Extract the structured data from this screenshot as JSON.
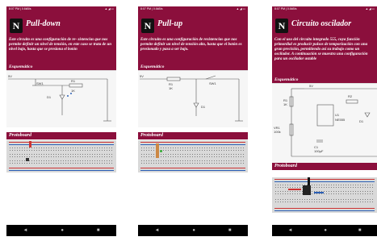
{
  "status_text": "8:07 PM | 0.6kB/s",
  "status_right": "▲ ◢ ▭",
  "logo_glyph": "N",
  "nav": {
    "back": "◄",
    "home": "●",
    "recents": "■"
  },
  "screens": [
    {
      "title": "Pull-down",
      "description": "Este circuito es una configuración de re- sistencias que nos permite definir un nivel de tensión, en este caso se trata de un nivel bajo, hasta que se presiona el botón",
      "schematic_label": "Esquemático",
      "protoboard_label": "Protoboard",
      "labels": {
        "vcc": "5V",
        "sw": "SW1",
        "r": "R1",
        "rv": "1K",
        "d": "D1"
      }
    },
    {
      "title": "Pull-up",
      "description": "Este circuito es una configuración de resistencias que nos permite definir un nivel de tensión alto, hasta que el botón es presionado y pasa a ser bajo.",
      "schematic_label": "Esquemático",
      "protoboard_label": "Protoboard",
      "labels": {
        "vcc": "5V",
        "sw": "SW1",
        "r": "R1",
        "rv": "1K",
        "d": "D1"
      }
    },
    {
      "title": "Circuito oscilador",
      "description": "Con el uso del circuito integrado 555, cuya función primordial es producir pulsos de temporización con una gran precisión, permitiendo así su trabajo como un oscilador. A continuación se muestra una configuración para un oscilador astable",
      "schematic_label": "Esquemático",
      "protoboard_label": "Protoboard",
      "labels": {
        "vcc": "5V",
        "r1": "R1",
        "r1v": "1K",
        "vr": "VR1",
        "vrv": "100k",
        "ic": "U1",
        "icv": "NE555",
        "c": "C1",
        "cv": "100µF",
        "r2": "R2",
        "d": "D1"
      }
    }
  ]
}
